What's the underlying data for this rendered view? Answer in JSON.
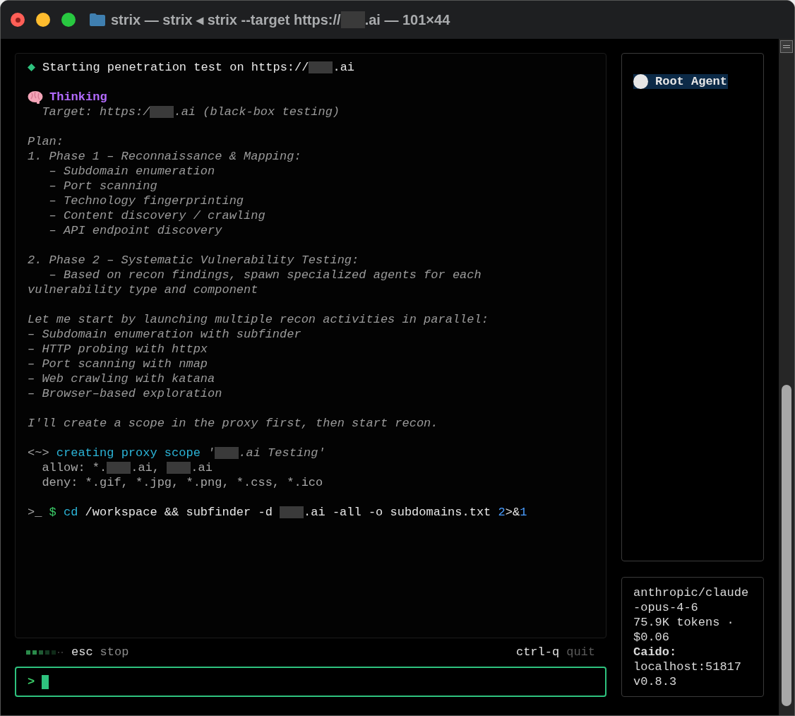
{
  "window": {
    "title_parts": [
      {
        "kind": "text",
        "text": "strix — strix ◂ strix --target https://"
      },
      {
        "kind": "redacted"
      },
      {
        "kind": "text",
        "text": ".ai — 101×44"
      }
    ]
  },
  "log": {
    "lines": [
      {
        "kind": "status",
        "parts": [
          {
            "kind": "text",
            "text": "Starting penetration test on https://"
          },
          {
            "kind": "redacted"
          },
          {
            "kind": "text",
            "text": ".ai"
          }
        ]
      },
      {
        "kind": "blank"
      },
      {
        "kind": "thinking",
        "parts": [
          {
            "kind": "text",
            "text": "Thinking"
          }
        ]
      },
      {
        "kind": "note",
        "parts": [
          {
            "kind": "text",
            "text": "  Target: https:/"
          },
          {
            "kind": "redacted"
          },
          {
            "kind": "text",
            "text": ".ai (black-box testing)"
          }
        ]
      },
      {
        "kind": "blank"
      },
      {
        "kind": "note",
        "parts": [
          {
            "kind": "text",
            "text": "Plan:"
          }
        ]
      },
      {
        "kind": "note",
        "parts": [
          {
            "kind": "text",
            "text": "1. Phase 1 – Reconnaissance & Mapping:"
          }
        ]
      },
      {
        "kind": "note",
        "parts": [
          {
            "kind": "text",
            "text": "   – Subdomain enumeration"
          }
        ]
      },
      {
        "kind": "note",
        "parts": [
          {
            "kind": "text",
            "text": "   – Port scanning"
          }
        ]
      },
      {
        "kind": "note",
        "parts": [
          {
            "kind": "text",
            "text": "   – Technology fingerprinting"
          }
        ]
      },
      {
        "kind": "note",
        "parts": [
          {
            "kind": "text",
            "text": "   – Content discovery / crawling"
          }
        ]
      },
      {
        "kind": "note",
        "parts": [
          {
            "kind": "text",
            "text": "   – API endpoint discovery"
          }
        ]
      },
      {
        "kind": "blank"
      },
      {
        "kind": "note",
        "parts": [
          {
            "kind": "text",
            "text": "2. Phase 2 – Systematic Vulnerability Testing:"
          }
        ]
      },
      {
        "kind": "note",
        "parts": [
          {
            "kind": "text",
            "text": "   – Based on recon findings, spawn specialized agents for each"
          }
        ]
      },
      {
        "kind": "note",
        "parts": [
          {
            "kind": "text",
            "text": "vulnerability type and component"
          }
        ]
      },
      {
        "kind": "blank"
      },
      {
        "kind": "note",
        "parts": [
          {
            "kind": "text",
            "text": "Let me start by launching multiple recon activities in parallel:"
          }
        ]
      },
      {
        "kind": "note",
        "parts": [
          {
            "kind": "text",
            "text": "– Subdomain enumeration with subfinder"
          }
        ]
      },
      {
        "kind": "note",
        "parts": [
          {
            "kind": "text",
            "text": "– HTTP probing with httpx"
          }
        ]
      },
      {
        "kind": "note",
        "parts": [
          {
            "kind": "text",
            "text": "– Port scanning with nmap"
          }
        ]
      },
      {
        "kind": "note",
        "parts": [
          {
            "kind": "text",
            "text": "– Web crawling with katana"
          }
        ]
      },
      {
        "kind": "note",
        "parts": [
          {
            "kind": "text",
            "text": "– Browser–based exploration"
          }
        ]
      },
      {
        "kind": "blank"
      },
      {
        "kind": "note",
        "parts": [
          {
            "kind": "text",
            "text": "I'll create a scope in the proxy first, then start recon."
          }
        ]
      },
      {
        "kind": "blank"
      },
      {
        "kind": "tool",
        "parts": [
          {
            "kind": "text",
            "text": "<~> "
          },
          {
            "kind": "accent",
            "text": "creating proxy scope"
          },
          {
            "kind": "italic",
            "text": " '"
          },
          {
            "kind": "redacted"
          },
          {
            "kind": "italic",
            "text": ".ai Testing'"
          }
        ]
      },
      {
        "kind": "tool",
        "parts": [
          {
            "kind": "text",
            "text": "  allow: *."
          },
          {
            "kind": "redacted"
          },
          {
            "kind": "text",
            "text": ".ai, "
          },
          {
            "kind": "redacted"
          },
          {
            "kind": "text",
            "text": ".ai"
          }
        ]
      },
      {
        "kind": "tool",
        "parts": [
          {
            "kind": "text",
            "text": "  deny: *.gif, *.jpg, *.png, *.css, *.ico"
          }
        ]
      },
      {
        "kind": "blank"
      },
      {
        "kind": "command",
        "parts": [
          {
            "kind": "text",
            "text": ">_ "
          },
          {
            "kind": "prompt",
            "text": "$ "
          },
          {
            "kind": "accent",
            "text": "cd"
          },
          {
            "kind": "bright",
            "text": " /workspace && subfinder -d "
          },
          {
            "kind": "redacted"
          },
          {
            "kind": "bright",
            "text": ".ai -all -o subdomains.txt "
          },
          {
            "kind": "number",
            "text": "2"
          },
          {
            "kind": "bright",
            "text": ">&"
          },
          {
            "kind": "number",
            "text": "1"
          }
        ]
      }
    ]
  },
  "status_bar": {
    "left_key": "esc",
    "left_action": "stop",
    "right_key": "ctrl-q",
    "right_action": "quit"
  },
  "input": {
    "prompt": ">"
  },
  "agents": [
    {
      "name": "Root Agent",
      "selected": true
    }
  ],
  "info": [
    {
      "kind": "plain",
      "text": "anthropic/claude"
    },
    {
      "kind": "plain",
      "text": "-opus-4-6"
    },
    {
      "kind": "plain",
      "text": "75.9K tokens ·"
    },
    {
      "kind": "plain",
      "text": "$0.06"
    },
    {
      "kind": "bold",
      "text": "Caido:"
    },
    {
      "kind": "plain",
      "text": "localhost:51817"
    },
    {
      "kind": "plain",
      "text": "v0.8.3"
    }
  ]
}
